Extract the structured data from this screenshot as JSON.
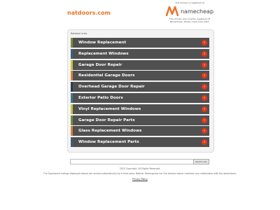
{
  "header": {
    "domain": "natdoors.com",
    "registrar_top": "This domain is registered at",
    "registrar_name": "namecheap",
    "registrar_bottom": "This domain was recently registered at Namecheap. Please check back later!"
  },
  "panel": {
    "title": "Related Links",
    "links": [
      {
        "label": "Window Replacement",
        "accent": "#7a8c3c"
      },
      {
        "label": "Replacement Windows",
        "accent": "#3c5f7a"
      },
      {
        "label": "Garage Door Repair",
        "accent": "#c7c23c"
      },
      {
        "label": "Residential Garage Doors",
        "accent": "#d9823a"
      },
      {
        "label": "Overhead Garage Door Repair",
        "accent": "#2b3c4d"
      },
      {
        "label": "Exterior Patio Doors",
        "accent": "#3c7a8c"
      },
      {
        "label": "Vinyl Replacement Windows",
        "accent": "#c7c23c"
      },
      {
        "label": "Garage Door Repair Parts",
        "accent": "#7a8c3c"
      },
      {
        "label": "Glass Replacement Windows",
        "accent": "#d9823a"
      },
      {
        "label": "Window Replacement Parts",
        "accent": "#3c5f7a"
      }
    ],
    "arrow_icon": "arrow-right-icon"
  },
  "search": {
    "placeholder": "",
    "button_label": "Search Ads"
  },
  "footer": {
    "copyright": "2025 Copyright. All Rights Reserved.",
    "disclaimer": "The Sponsored Listings displayed above are served automatically by a third party. Neither Parkingcrew nor the domain owner maintain any relationship with the advertisers.",
    "privacy_label": "Privacy Policy"
  },
  "colors": {
    "brand_orange": "#e8742a",
    "link_bg": "#505050",
    "arrow_red": "#e03a1c"
  }
}
